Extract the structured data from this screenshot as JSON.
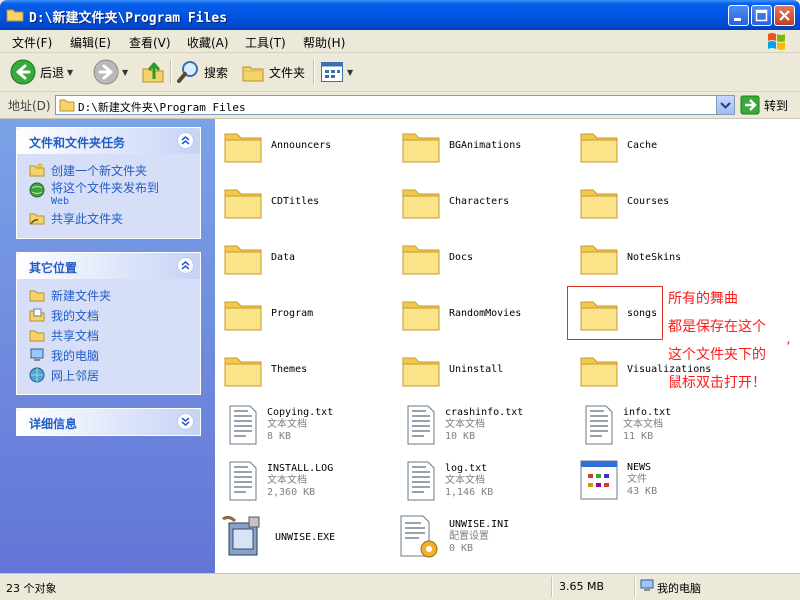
{
  "window": {
    "title": "D:\\新建文件夹\\Program Files"
  },
  "menu": [
    "文件(F)",
    "编辑(E)",
    "查看(V)",
    "收藏(A)",
    "工具(T)",
    "帮助(H)"
  ],
  "toolbar": {
    "back_label": "后退",
    "search_label": "搜索",
    "folders_label": "文件夹"
  },
  "address": {
    "label": "地址(D)",
    "value": "D:\\新建文件夹\\Program Files",
    "go_label": "转到"
  },
  "tasks": {
    "title": "文件和文件夹任务",
    "items": [
      "创建一个新文件夹",
      "将这个文件夹发布到",
      "Web",
      "共享此文件夹"
    ]
  },
  "places": {
    "title": "其它位置",
    "items": [
      "新建文件夹",
      "我的文档",
      "共享文档",
      "我的电脑",
      "网上邻居"
    ]
  },
  "details": {
    "title": "详细信息"
  },
  "folders": [
    "Announcers",
    "BGAnimations",
    "Cache",
    "CDTitles",
    "Characters",
    "Courses",
    "Data",
    "Docs",
    "NoteSkins",
    "Program",
    "RandomMovies",
    "songs",
    "Themes",
    "Uninstall",
    "Visualizations"
  ],
  "files": [
    {
      "name": "Copying.txt",
      "type": "文本文档",
      "size": "8 KB",
      "icon": "text-file-icon"
    },
    {
      "name": "crashinfo.txt",
      "type": "文本文档",
      "size": "10 KB",
      "icon": "text-file-icon"
    },
    {
      "name": "info.txt",
      "type": "文本文档",
      "size": "11 KB",
      "icon": "text-file-icon"
    },
    {
      "name": "INSTALL.LOG",
      "type": "文本文档",
      "size": "2,360 KB",
      "icon": "text-file-icon"
    },
    {
      "name": "log.txt",
      "type": "文本文档",
      "size": "1,146 KB",
      "icon": "text-file-icon"
    },
    {
      "name": "NEWS",
      "type": "文件",
      "size": "43 KB",
      "icon": "generic-file-icon"
    },
    {
      "name": "UNWISE.EXE",
      "type": "",
      "size": "",
      "icon": "installer-icon"
    },
    {
      "name": "UNWISE.INI",
      "type": "配置设置",
      "size": "0 KB",
      "icon": "config-file-icon"
    }
  ],
  "annotation": {
    "lines": [
      "所有的舞曲",
      "都是保存在这个",
      "这个文件夹下的",
      "鼠标双击打开！"
    ],
    "mark": "’"
  },
  "status": {
    "count": "23 个对象",
    "size": "3.65 MB",
    "location": "我的电脑"
  },
  "colors": {
    "titlebar": "#0054e3",
    "task_pane": "#6f8fe0",
    "link": "#215dc6",
    "annotation": "#ff1a1a"
  }
}
